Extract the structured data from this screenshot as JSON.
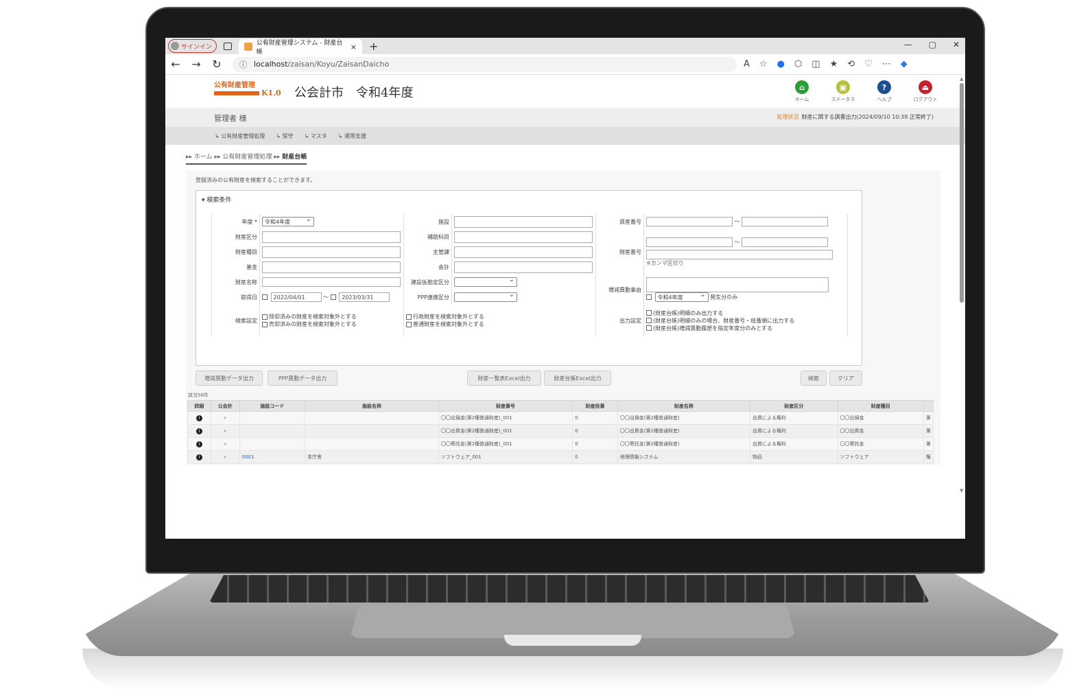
{
  "browser": {
    "signin_label": "サインイン",
    "tab_title": "公有財産管理システム - 財産台帳",
    "tab_close": "×",
    "new_tab": "+",
    "url_host": "localhost",
    "url_path": "/zaisan/Koyu/ZaisanDaicho",
    "win_min": "—",
    "win_max": "▢",
    "win_close": "✕"
  },
  "app": {
    "logo_text": "公有財産管理",
    "version": "K1.0",
    "title": "公会計市　令和4年度",
    "user": "管理者 様",
    "status_label": "処理状況",
    "status_text": "財産に関する調書出力(2024/09/10 10:39 正常終了)",
    "header_icons": [
      {
        "label": "ホーム",
        "icon": "home-icon",
        "color": "#2e9c3a",
        "glyph": "⌂"
      },
      {
        "label": "ステータス",
        "icon": "status-icon",
        "color": "#b6c13a",
        "glyph": "▣"
      },
      {
        "label": "ヘルプ",
        "icon": "help-icon",
        "color": "#1d4e8f",
        "glyph": "?"
      },
      {
        "label": "ログアウト",
        "icon": "logout-icon",
        "color": "#c4232d",
        "glyph": "⏏"
      }
    ],
    "menu": [
      "↳ 公有財産管理処理",
      "↳ 保守",
      "↳ マスタ",
      "↳ 運用支援"
    ]
  },
  "breadcrumb": {
    "home": "ホーム",
    "section": "公有財産管理処理",
    "current": "財産台帳"
  },
  "search": {
    "description": "登録済みの公有財産を検索することができます。",
    "legend": "検索条件",
    "labels": {
      "nendo": "年度",
      "required": "*",
      "shisetsu": "施設",
      "shisan_bango": "資産番号",
      "zaisan_kubun": "財産区分",
      "hojo_kamoku": "補助科目",
      "zaisan_shumoku": "財産種目",
      "shukanka": "主管課",
      "zaisan_bango": "財産番号",
      "kikin": "基金",
      "kaikei": "会計",
      "zaisan_meisho": "財産名称",
      "kenkari": "建設仮勘定区分",
      "zogen_jiyu": "増減異動事由",
      "shutokubi": "取得日",
      "ppp": "PPP連携区分",
      "kensaku_settei": "検索設定",
      "shutsuryoku_settei": "出力設定",
      "tilde": "～",
      "comma_note": "※カンマ区切り",
      "hassei_only": "発生分のみ"
    },
    "values": {
      "nendo": "令和4年度",
      "date_from": "2022/04/01",
      "date_to": "2023/03/31",
      "zogen_nendo": "令和4年度"
    },
    "search_options": [
      "除却済みの財産を検索対象外とする",
      "売却済みの財産を検索対象外とする"
    ],
    "search_options2": [
      "行政財産を検索対象外とする",
      "普通財産を検索対象外とする"
    ],
    "output_options": [
      "(財産台帳)明細のみ出力する",
      "(財産台帳)明細のみの場合、財産番号・枝番順に出力する",
      "(財産台帳)増減異動履歴を指定年度分のみとする"
    ],
    "buttons": {
      "zogen_export": "増減異動データ出力",
      "ppp_export": "PPP異動データ出力",
      "list_excel": "財産一覧表Excel出力",
      "ledger_excel": "財産台帳Excel出力",
      "search": "検索",
      "clear": "クリア"
    }
  },
  "results": {
    "count_text": "該当56件",
    "columns": [
      "詳細",
      "公会計",
      "施設コード",
      "施設名称",
      "財産番号",
      "財産枝番",
      "財産名称",
      "財産区分",
      "財産種目",
      ""
    ],
    "rows": [
      {
        "code": "",
        "shisetsu": "",
        "bango": "〇〇出捐金(第2種普通財産)_001",
        "eda": "0",
        "meisho": "〇〇出捐金(第2種普通財産)",
        "kubun": "出資による権利",
        "shumoku": "〇〇出捐金",
        "extra": "第"
      },
      {
        "code": "",
        "shisetsu": "",
        "bango": "〇〇出資金(第2種普通財産)_001",
        "eda": "0",
        "meisho": "〇〇出資金(第2種普通財産)",
        "kubun": "出資による権利",
        "shumoku": "〇〇出資金",
        "extra": "第"
      },
      {
        "code": "",
        "shisetsu": "",
        "bango": "〇〇寄託金(第2種普通財産)_001",
        "eda": "0",
        "meisho": "〇〇寄託金(第2種普通財産)",
        "kubun": "出資による権利",
        "shumoku": "〇〇寄託金",
        "extra": "第"
      },
      {
        "code": "0001",
        "shisetsu": "本庁舎",
        "bango": "ソフトウェア_001",
        "eda": "0",
        "meisho": "地理情報システム",
        "kubun": "物品",
        "shumoku": "ソフトウェア",
        "extra": "権"
      }
    ]
  }
}
